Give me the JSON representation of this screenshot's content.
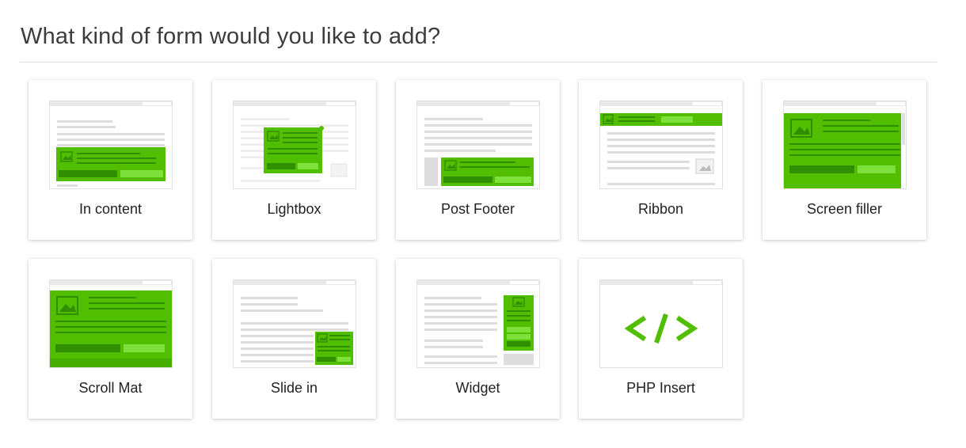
{
  "heading": "What kind of form would you like to add?",
  "colors": {
    "accent_green": "#52be00",
    "dark_green": "#2f8f00",
    "light_green": "#7ee03a",
    "frame_gray": "#e0e0e0",
    "line_gray": "#d2d2d2"
  },
  "form_types": [
    {
      "label": "In content",
      "icon": "in-content-icon"
    },
    {
      "label": "Lightbox",
      "icon": "lightbox-icon"
    },
    {
      "label": "Post Footer",
      "icon": "post-footer-icon"
    },
    {
      "label": "Ribbon",
      "icon": "ribbon-icon"
    },
    {
      "label": "Screen filler",
      "icon": "screen-filler-icon"
    },
    {
      "label": "Scroll Mat",
      "icon": "scroll-mat-icon"
    },
    {
      "label": "Slide in",
      "icon": "slide-in-icon"
    },
    {
      "label": "Widget",
      "icon": "widget-icon"
    },
    {
      "label": "PHP Insert",
      "icon": "php-insert-icon"
    }
  ]
}
